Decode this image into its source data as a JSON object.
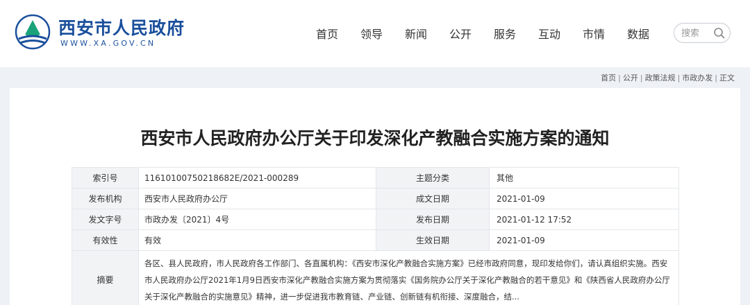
{
  "site": {
    "title": "西安市人民政府",
    "url": "WWW.XA.GOV.CN"
  },
  "nav": [
    {
      "label": "首页"
    },
    {
      "label": "领导"
    },
    {
      "label": "新闻"
    },
    {
      "label": "公开"
    },
    {
      "label": "服务"
    },
    {
      "label": "互动"
    },
    {
      "label": "市情"
    },
    {
      "label": "数据"
    }
  ],
  "search": {
    "placeholder": "搜索",
    "icon": "search-icon"
  },
  "breadcrumb": [
    "首页",
    "公开",
    "政策法规",
    "市政办发",
    "正文"
  ],
  "document": {
    "title": "西安市人民政府办公厅关于印发深化产教融合实施方案的通知"
  },
  "metadata": {
    "rows": [
      {
        "label1": "索引号",
        "value1": "11610100750218682E/2021-000289",
        "label2": "主题分类",
        "value2": "其他"
      },
      {
        "label1": "发布机构",
        "value1": "西安市人民政府办公厅",
        "label2": "成文日期",
        "value2": "2021-01-09"
      },
      {
        "label1": "发文字号",
        "value1": "市政办发〔2021〕4号",
        "label2": "发布日期",
        "value2": "2021-01-12 17:52"
      },
      {
        "label1": "有效性",
        "value1": "有效",
        "label2": "生效日期",
        "value2": "2021-01-09"
      }
    ],
    "abstract_label": "摘要",
    "abstract_text": "各区、县人民政府，市人民政府各工作部门、各直属机构：《西安市深化产教融合实施方案》已经市政府同意，现印发给你们，请认真组织实施。西安市人民政府办公厅2021年1月9日西安市深化产教融合实施方案为贯彻落实《国务院办公厅关于深化产教融合的若干意见》和《陕西省人民政府办公厅关于深化产教融合的实施意见》精神，进一步促进我市教育链、产业链、创新链有机衔接、深度融合，结..."
  },
  "colors": {
    "brand": "#1a4f9c",
    "page_bg": "#eef1f6",
    "label_bg": "#f2f3f5"
  }
}
